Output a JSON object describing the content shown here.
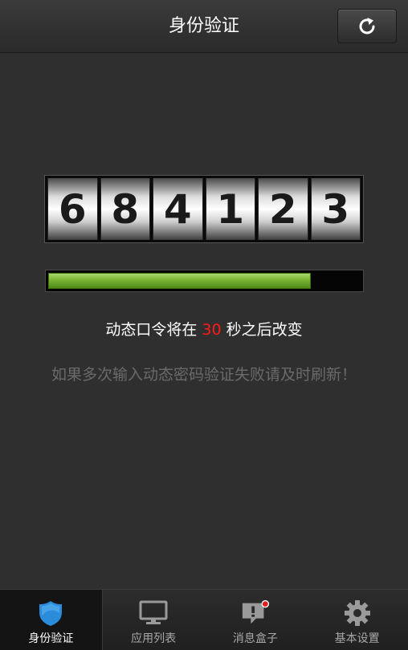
{
  "header": {
    "title": "身份验证",
    "refresh_icon": "refresh-icon"
  },
  "code": {
    "digits": [
      "6",
      "8",
      "4",
      "1",
      "2",
      "3"
    ]
  },
  "progress": {
    "fraction": 0.84,
    "color": "#78b431"
  },
  "countdown": {
    "prefix": "动态口令将在",
    "seconds": "30",
    "suffix": "秒之后改变",
    "seconds_color": "#ff1a1a"
  },
  "hint": "如果多次输入动态密码验证失败请及时刷新！",
  "tabs": [
    {
      "label": "身份验证",
      "icon": "shield-icon",
      "active": true
    },
    {
      "label": "应用列表",
      "icon": "monitor-icon",
      "active": false
    },
    {
      "label": "消息盒子",
      "icon": "message-alert-icon",
      "active": false
    },
    {
      "label": "基本设置",
      "icon": "gear-icon",
      "active": false
    }
  ],
  "colors": {
    "accent": "#2a8cdb",
    "badge": "#e02020"
  }
}
